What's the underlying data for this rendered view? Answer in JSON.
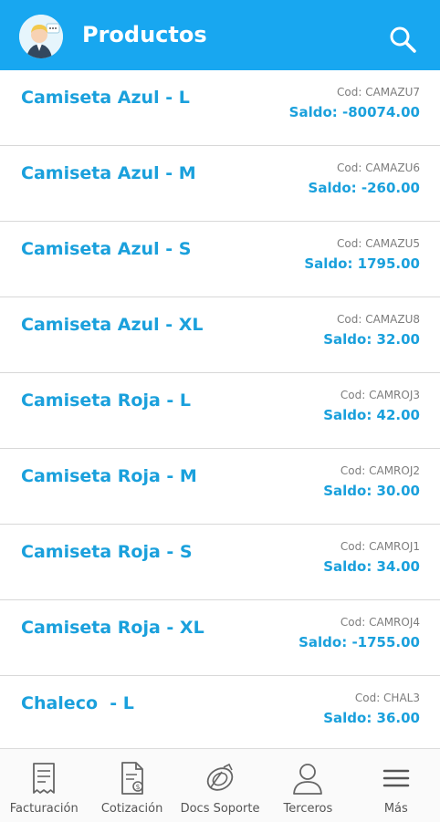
{
  "header": {
    "title": "Productos",
    "avatar_icon": "user-avatar-icon",
    "search_icon": "search-icon",
    "accent_color": "#18a7f0"
  },
  "products": [
    {
      "name": "Camiseta Azul - L",
      "code": "Cod: CAMAZU7",
      "balance": "Saldo: -80074.00"
    },
    {
      "name": "Camiseta Azul - M",
      "code": "Cod: CAMAZU6",
      "balance": "Saldo: -260.00"
    },
    {
      "name": "Camiseta Azul - S",
      "code": "Cod: CAMAZU5",
      "balance": "Saldo: 1795.00"
    },
    {
      "name": "Camiseta Azul - XL",
      "code": "Cod: CAMAZU8",
      "balance": "Saldo: 32.00"
    },
    {
      "name": "Camiseta Roja - L",
      "code": "Cod: CAMROJ3",
      "balance": "Saldo: 42.00"
    },
    {
      "name": "Camiseta Roja - M",
      "code": "Cod: CAMROJ2",
      "balance": "Saldo: 30.00"
    },
    {
      "name": "Camiseta Roja - S",
      "code": "Cod: CAMROJ1",
      "balance": "Saldo: 34.00"
    },
    {
      "name": "Camiseta Roja - XL",
      "code": "Cod: CAMROJ4",
      "balance": "Saldo: -1755.00"
    },
    {
      "name": "Chaleco  - L",
      "code": "Cod: CHAL3",
      "balance": "Saldo: 36.00"
    }
  ],
  "bottom_nav": [
    {
      "label": "Facturación",
      "icon": "receipt-icon"
    },
    {
      "label": "Cotización",
      "icon": "quote-document-icon"
    },
    {
      "label": "Docs Soporte",
      "icon": "support-docs-icon"
    },
    {
      "label": "Terceros",
      "icon": "person-icon"
    },
    {
      "label": "Más",
      "icon": "menu-icon"
    }
  ]
}
